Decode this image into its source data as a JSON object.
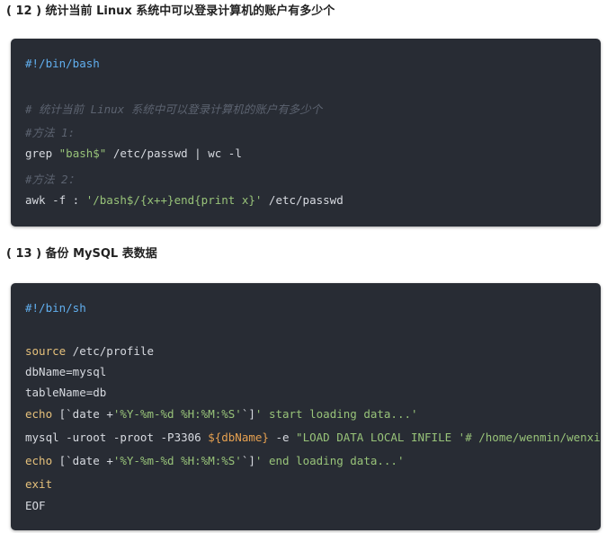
{
  "section12": {
    "heading": "( 12 ) 统计当前 Linux 系统中可以登录计算机的账户有多少个",
    "code": {
      "shebang": "#!/bin/bash",
      "comment1": "# 统计当前 Linux 系统中可以登录计算机的账户有多少个",
      "comment2": "#方法 1:",
      "grep_cmd": "grep ",
      "grep_pattern": "\"bash$\"",
      "grep_rest": " /etc/passwd | wc -l",
      "comment3": "#方法 2：",
      "awk_cmd": "awk -f : ",
      "awk_script": "'/bash$/{x++}end{print x}'",
      "awk_rest": " /etc/passwd"
    }
  },
  "section13": {
    "heading": "( 13 ) 备份 MySQL 表数据",
    "code": {
      "shebang": "#!/bin/sh",
      "source_kw": "source",
      "source_rest": " /etc/profile",
      "dbname_line": "dbName=mysql",
      "tablename_line": "tableName=db",
      "echo1_kw": "echo",
      "echo1_pre": " [`date +",
      "echo1_fmt": "'%Y-%m-%d %H:%M:%S'",
      "echo1_mid": "`]",
      "echo1_msg": "' start loading data...'",
      "mysql_cmd": "mysql -uroot -proot -P3306 ",
      "mysql_var": "${dbName}",
      "mysql_opt": " -e ",
      "mysql_str": "\"LOAD DATA LOCAL INFILE '# /home/wenmin/wenxi",
      "echo2_kw": "echo",
      "echo2_pre": " [`date +",
      "echo2_fmt": "'%Y-%m-%d %H:%M:%S'",
      "echo2_mid": "`]",
      "echo2_msg": "' end loading data...'",
      "exit_kw": "exit",
      "eof_line": "EOF"
    }
  },
  "colors": {
    "code_bg": "#282c34",
    "comment": "#5c6370",
    "keyword": "#e5c07b",
    "string": "#98c379",
    "shebang": "#61afef"
  }
}
